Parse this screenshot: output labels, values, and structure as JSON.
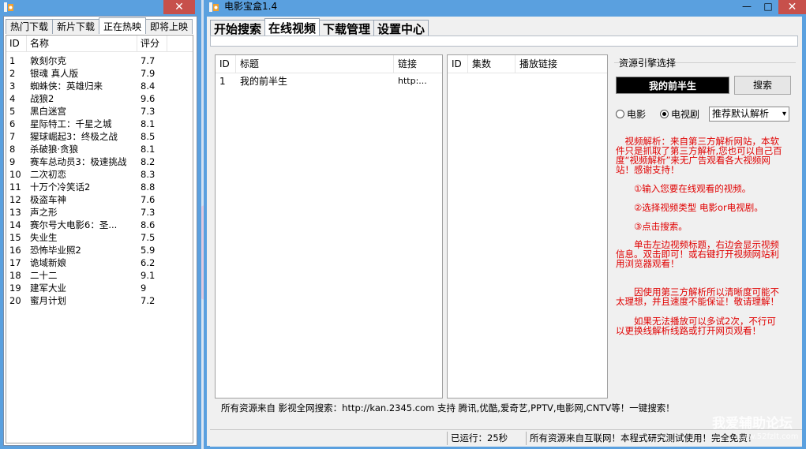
{
  "left_window": {
    "tabs": [
      "热门下载",
      "新片下载",
      "正在热映",
      "即将上映"
    ],
    "active_tab": 2,
    "close_glyph": "✕",
    "columns": [
      "ID",
      "名称",
      "评分"
    ],
    "rows": [
      {
        "id": "1",
        "name": "敦刻尔克",
        "score": "7.7"
      },
      {
        "id": "2",
        "name": "银魂 真人版",
        "score": "7.9"
      },
      {
        "id": "3",
        "name": "蜘蛛侠：英雄归来",
        "score": "8.4"
      },
      {
        "id": "4",
        "name": "战狼2",
        "score": "9.6"
      },
      {
        "id": "5",
        "name": "黑白迷宫",
        "score": "7.3"
      },
      {
        "id": "6",
        "name": "星际特工：千星之城",
        "score": "8.1"
      },
      {
        "id": "7",
        "name": "猩球崛起3：终极之战",
        "score": "8.5"
      },
      {
        "id": "8",
        "name": "杀破狼·贪狼",
        "score": "8.1"
      },
      {
        "id": "9",
        "name": "赛车总动员3：极速挑战",
        "score": "8.2"
      },
      {
        "id": "10",
        "name": "二次初恋",
        "score": "8.3"
      },
      {
        "id": "11",
        "name": "十万个冷笑话2",
        "score": "8.8"
      },
      {
        "id": "12",
        "name": "极盗车神",
        "score": "7.6"
      },
      {
        "id": "13",
        "name": "声之形",
        "score": "7.3"
      },
      {
        "id": "14",
        "name": "赛尔号大电影6：圣...",
        "score": "8.6"
      },
      {
        "id": "15",
        "name": "失业生",
        "score": "7.5"
      },
      {
        "id": "16",
        "name": "恐怖毕业照2",
        "score": "5.9"
      },
      {
        "id": "17",
        "name": "诡域新娘",
        "score": "6.2"
      },
      {
        "id": "18",
        "name": "二十二",
        "score": "9.1"
      },
      {
        "id": "19",
        "name": "建军大业",
        "score": "9"
      },
      {
        "id": "20",
        "name": "蜜月计划",
        "score": "7.2"
      }
    ]
  },
  "main_window": {
    "title": "电影宝盒1.4",
    "min_glyph": "—",
    "max_glyph": "□",
    "close_glyph": "✕",
    "tabs": [
      "开始搜索",
      "在线视频",
      "下载管理",
      "设置中心"
    ],
    "active_tab": 1,
    "video_table": {
      "columns": [
        "ID",
        "标题",
        "链接"
      ],
      "rows": [
        {
          "id": "1",
          "title": "我的前半生",
          "link": "http:..."
        }
      ]
    },
    "episode_table": {
      "columns": [
        "ID",
        "集数",
        "播放链接"
      ]
    },
    "engine": {
      "label": "资源引擎选择",
      "query": "我的前半生",
      "search_label": "搜索",
      "radio_movie": "电影",
      "radio_tv": "电视剧",
      "selected_radio": "tv",
      "parser_selected": "推荐默认解析",
      "parser_arrow": "▾"
    },
    "help_texts": [
      "　视频解析：来自第三方解析网站，本软件只是抓取了第三方解析,您也可以自己百度“视频解析”来无广告观看各大视频网站！感谢支持！",
      "　　①输入您要在线观看的视频。",
      "　　②选择视频类型 电影or电视剧。",
      "　　③点击搜索。",
      "　　单击左边视频标题，右边会显示视频信息。双击即可！或右键打开视频网站利用浏览器观看！",
      "　　因使用第三方解析所以清晰度可能不太理想，并且速度不能保证！敬请理解！",
      "　　如果无法播放可以多试2次，不行可以更换线解析线路或打开网页观看！"
    ],
    "footer": "所有资源来自 影视全网搜索：http://kan.2345.com 支持 腾讯,优酷,爱奇艺,PPTV,电影网,CNTV等！一键搜索！",
    "status": {
      "running": "已运行：25秒",
      "notice": "所有资源来自互联网！本程式研究测试使用！完全免费！"
    }
  },
  "watermark": {
    "text": "我爱辅助论坛",
    "sub": "www.52fzlt.com"
  },
  "colors": {
    "window_border": "#5aa0df",
    "close": "#c7504b",
    "help_red": "#e00000"
  }
}
